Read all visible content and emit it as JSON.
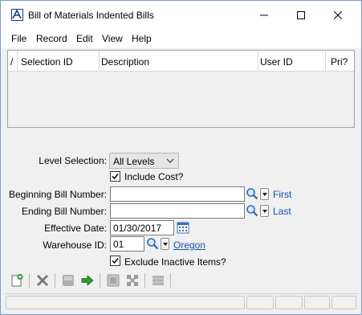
{
  "window": {
    "title": "Bill of Materials Indented Bills"
  },
  "menu": [
    "File",
    "Record",
    "Edit",
    "View",
    "Help"
  ],
  "grid": {
    "sort_indicator": "/",
    "columns": [
      "Selection ID",
      "Description",
      "User ID",
      "Pri?"
    ],
    "rows": []
  },
  "form": {
    "level_selection": {
      "label": "Level Selection:",
      "value": "All Levels"
    },
    "include_cost": {
      "label": "Include Cost?",
      "checked": true
    },
    "beginning_bill": {
      "label": "Beginning Bill Number:",
      "value": "",
      "link": "First"
    },
    "ending_bill": {
      "label": "Ending Bill Number:",
      "value": "",
      "link": "Last"
    },
    "effective_date": {
      "label": "Effective Date:",
      "value": "01/30/2017"
    },
    "warehouse": {
      "label": "Warehouse ID:",
      "value": "01",
      "link": "Oregon"
    },
    "exclude_inactive": {
      "label": "Exclude Inactive Items?",
      "checked": true
    }
  },
  "toolbar": [
    "new-icon",
    "delete-icon",
    "save-icon",
    "proceed-arrow-icon",
    "print-icon",
    "setup-icon",
    "list-icon"
  ],
  "colors": {
    "link": "#1a52a8",
    "accent_green": "#2f9a2a",
    "logo_blue": "#1a3a8f"
  }
}
